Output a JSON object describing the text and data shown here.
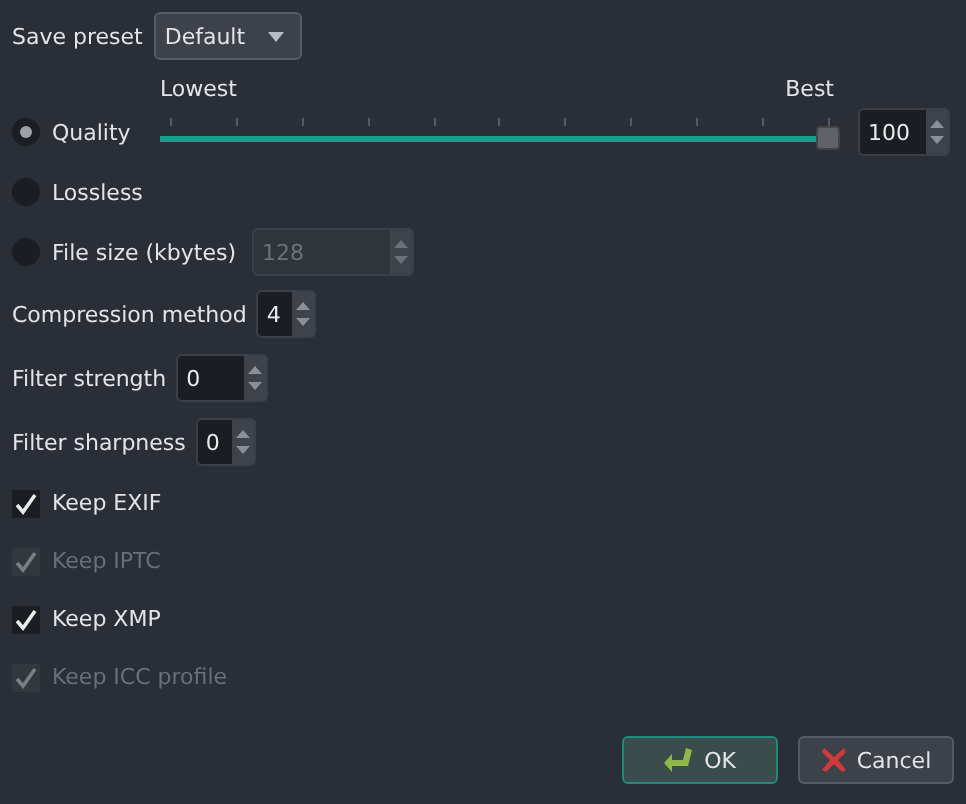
{
  "preset": {
    "label": "Save preset",
    "value": "Default"
  },
  "quality_scale": {
    "low": "Lowest",
    "high": "Best"
  },
  "modes": [
    {
      "kind": "slider",
      "label": "Quality",
      "selected": true,
      "level": 1,
      "value": "100",
      "disabled": false
    },
    {
      "kind": "plain",
      "label": "Lossless",
      "selected": false
    },
    {
      "kind": "spin",
      "label": "File size (kbytes)",
      "selected": false,
      "value": "128",
      "disabled": true
    }
  ],
  "spins": [
    {
      "label": "Compression method",
      "value": "4",
      "wide": false
    },
    {
      "label": "Filter strength",
      "value": "0",
      "wide": true
    },
    {
      "label": "Filter sharpness",
      "value": "0",
      "wide": false
    }
  ],
  "checks": [
    {
      "label": "Keep EXIF",
      "checked": true,
      "disabled": false
    },
    {
      "label": "Keep IPTC",
      "checked": true,
      "disabled": true
    },
    {
      "label": "Keep XMP",
      "checked": true,
      "disabled": false
    },
    {
      "label": "Keep ICC profile",
      "checked": true,
      "disabled": true
    }
  ],
  "buttons": [
    {
      "kind": "ok",
      "label": "OK"
    },
    {
      "kind": "cancel",
      "label": "Cancel"
    }
  ]
}
